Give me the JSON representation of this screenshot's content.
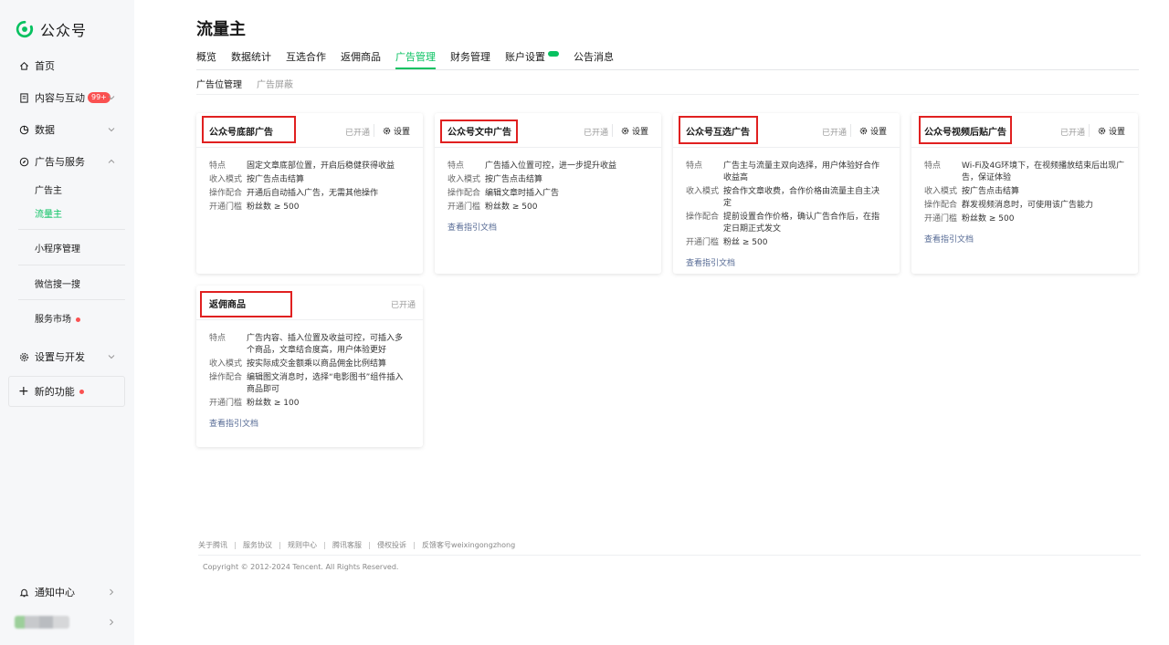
{
  "app": {
    "name": "公众号"
  },
  "sidebar": {
    "home": "首页",
    "content": "内容与互动",
    "content_badge": "99+",
    "data": "数据",
    "ads": "广告与服务",
    "ads_sub": [
      "广告主",
      "流量主"
    ],
    "mini_program": "小程序管理",
    "search": "微信搜一搜",
    "market": "服务市场",
    "settings": "设置与开发",
    "new_features": "新的功能",
    "notifications": "通知中心"
  },
  "page": {
    "title": "流量主",
    "tabs": [
      "概览",
      "数据统计",
      "互选合作",
      "返佣商品",
      "广告管理",
      "财务管理",
      "账户设置",
      "公告消息"
    ],
    "active_tab": "广告管理",
    "subtabs": [
      "广告位管理",
      "广告屏蔽"
    ]
  },
  "cards": [
    {
      "title": "公众号底部广告",
      "status": "已开通",
      "setting": "设置",
      "rows": [
        {
          "k": "特点",
          "v": "固定文章底部位置，开启后稳健获得收益"
        },
        {
          "k": "收入模式",
          "v": "按广告点击结算"
        },
        {
          "k": "操作配合",
          "v": "开通后自动插入广告，无需其他操作"
        },
        {
          "k": "开通门槛",
          "v": "粉丝数 ≥ 500"
        }
      ],
      "link": ""
    },
    {
      "title": "公众号文中广告",
      "status": "已开通",
      "setting": "设置",
      "rows": [
        {
          "k": "特点",
          "v": "广告插入位置可控，进一步提升收益"
        },
        {
          "k": "收入模式",
          "v": "按广告点击结算"
        },
        {
          "k": "操作配合",
          "v": "编辑文章时插入广告"
        },
        {
          "k": "开通门槛",
          "v": "粉丝数 ≥ 500"
        }
      ],
      "link": "查看指引文档"
    },
    {
      "title": "公众号互选广告",
      "status": "已开通",
      "setting": "设置",
      "rows": [
        {
          "k": "特点",
          "v": "广告主与流量主双向选择，用户体验好合作收益高"
        },
        {
          "k": "收入模式",
          "v": "按合作文章收费，合作价格由流量主自主决定"
        },
        {
          "k": "操作配合",
          "v": "提前设置合作价格，确认广告合作后，在指定日期正式发文"
        },
        {
          "k": "开通门槛",
          "v": "粉丝 ≥ 500"
        }
      ],
      "link": "查看指引文档"
    },
    {
      "title": "公众号视频后贴广告",
      "status": "已开通",
      "setting": "设置",
      "rows": [
        {
          "k": "特点",
          "v": "Wi-Fi及4G环境下，在视频播放结束后出现广告，保证体验"
        },
        {
          "k": "收入模式",
          "v": "按广告点击结算"
        },
        {
          "k": "操作配合",
          "v": "群发视频消息时，可使用该广告能力"
        },
        {
          "k": "开通门槛",
          "v": "粉丝数 ≥ 500"
        }
      ],
      "link": "查看指引文档"
    },
    {
      "title": "返佣商品",
      "status": "已开通",
      "setting": "",
      "rows": [
        {
          "k": "特点",
          "v": "广告内容、插入位置及收益可控，可插入多个商品，文章结合度高，用户体验更好"
        },
        {
          "k": "收入模式",
          "v": "按实际成交金额乘以商品佣金比例结算"
        },
        {
          "k": "操作配合",
          "v": "编辑图文消息时，选择“电影图书”组件插入商品即可"
        },
        {
          "k": "开通门槛",
          "v": "粉丝数 ≥ 100"
        }
      ],
      "link": "查看指引文档"
    }
  ],
  "footer": {
    "links": [
      "关于腾讯",
      "服务协议",
      "规则中心",
      "腾讯客服",
      "侵权投诉",
      "反馈客号weixingongzhong"
    ],
    "copyright": "Copyright © 2012-2024 Tencent. All Rights Reserved."
  },
  "colors": {
    "accent": "#07c160",
    "highlight_box": "#e02020",
    "badge": "#fa5151",
    "link": "#576b95"
  }
}
